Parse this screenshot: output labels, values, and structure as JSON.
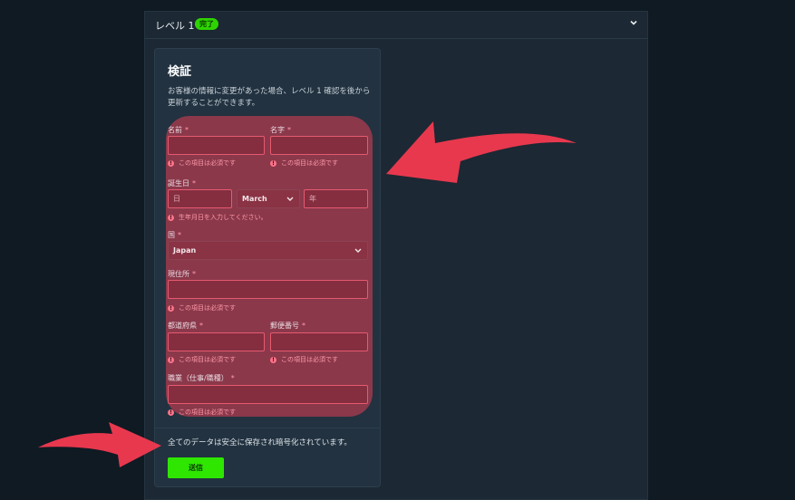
{
  "level": {
    "title": "レベル 1",
    "badge": "完了"
  },
  "card": {
    "title": "検証",
    "description": "お客様の情報に変更があった場合、レベル 1 確認を後から更新することができます。"
  },
  "form": {
    "required_mark": "*",
    "first_name": {
      "label": "名前",
      "value": "",
      "error": "この項目は必須です"
    },
    "last_name": {
      "label": "名字",
      "value": "",
      "error": "この項目は必須です"
    },
    "birthdate": {
      "label": "誕生日",
      "day_placeholder": "日",
      "month_value": "March",
      "year_placeholder": "年",
      "error": "生年月日を入力してください。"
    },
    "country": {
      "label": "国",
      "value": "Japan"
    },
    "address": {
      "label": "現住所",
      "value": "",
      "error": "この項目は必須です"
    },
    "prefecture": {
      "label": "都道府県",
      "value": "",
      "error": "この項目は必須です"
    },
    "postal_code": {
      "label": "郵便番号",
      "value": "",
      "error": "この項目は必須です"
    },
    "occupation": {
      "label": "職業（仕事/職種）",
      "value": "",
      "error": "この項目は必須です"
    }
  },
  "footer": {
    "secure_text": "全てのデータは安全に保存され暗号化されています。",
    "submit_label": "送信"
  },
  "colors": {
    "highlight": "#e23e54",
    "accent_green": "#2ee600",
    "arrow_red": "#e8384e"
  },
  "icons": [
    "chevron-down-icon",
    "error-icon",
    "arrow-annotation-icon"
  ]
}
